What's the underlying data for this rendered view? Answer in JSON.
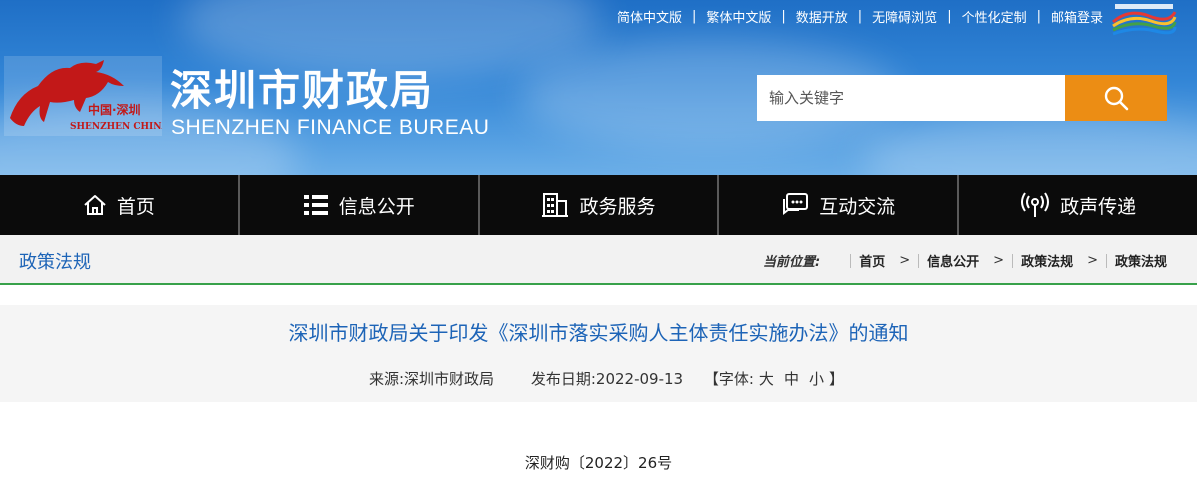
{
  "header": {
    "top_links": [
      "简体中文版",
      "繁体中文版",
      "数据开放",
      "无障碍浏览",
      "个性化定制",
      "邮箱登录"
    ],
    "logo_text_cn": "中国·深圳",
    "logo_text_en": "SHENZHEN CHINA",
    "title": "深圳市财政局",
    "subtitle": "SHENZHEN FINANCE BUREAU",
    "search_placeholder": "输入关键字"
  },
  "nav": {
    "items": [
      {
        "label": "首页",
        "icon": "home-icon"
      },
      {
        "label": "信息公开",
        "icon": "list-icon"
      },
      {
        "label": "政务服务",
        "icon": "building-icon"
      },
      {
        "label": "互动交流",
        "icon": "chat-icon"
      },
      {
        "label": "政声传递",
        "icon": "broadcast-icon"
      }
    ]
  },
  "breadcrumb": {
    "section": "政策法规",
    "label": "当前位置:",
    "items": [
      "首页",
      "信息公开",
      "政策法规",
      "政策法规"
    ]
  },
  "article": {
    "title": "深圳市财政局关于印发《深圳市落实采购人主体责任实施办法》的通知",
    "source": "来源:深圳市财政局",
    "date": "发布日期:2022-09-13",
    "font_label_open": "【字体:",
    "font_large": "大",
    "font_medium": "中",
    "font_small": "小",
    "font_label_close": "】",
    "doc_number": "深财购〔2022〕26号"
  },
  "colors": {
    "header_blue": "#2f7fd2",
    "search_button": "#ec8d14",
    "nav_bg": "#0b0b0b",
    "accent_green": "#38a14a",
    "link_blue": "#1d64b7"
  }
}
